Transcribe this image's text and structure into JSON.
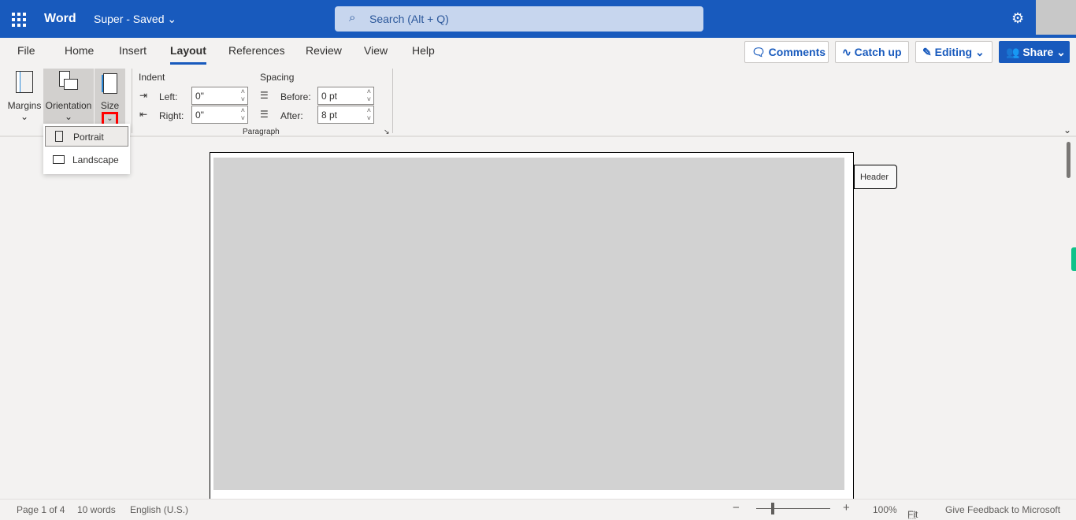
{
  "header": {
    "app": "Word",
    "doc_title": "Super - Saved",
    "search_placeholder": "Search (Alt + Q)"
  },
  "tabs": [
    "File",
    "Home",
    "Insert",
    "Layout",
    "References",
    "Review",
    "View",
    "Help"
  ],
  "active_tab": "Layout",
  "actions": {
    "comments": "Comments",
    "catchup": "Catch up",
    "editing": "Editing",
    "share": "Share"
  },
  "ribbon": {
    "margins": "Margins",
    "orientation": "Orientation",
    "size": "Size",
    "indent": "Indent",
    "left": "Left:",
    "right": "Right:",
    "left_val": "0\"",
    "right_val": "0\"",
    "spacing": "Spacing",
    "before": "Before:",
    "after": "After:",
    "before_val": "0 pt",
    "after_val": "8 pt",
    "group": "Paragraph"
  },
  "orientation_menu": [
    "Portrait",
    "Landscape"
  ],
  "header_tag": "Header",
  "status": {
    "page": "Page 1 of 4",
    "words": "10 words",
    "lang": "English (U.S.)",
    "zoom": "100%",
    "fit": "Fit",
    "feedback": "Give Feedback to Microsoft"
  },
  "colors": {
    "brand": "#185abd",
    "highlight": "#ff0000"
  }
}
